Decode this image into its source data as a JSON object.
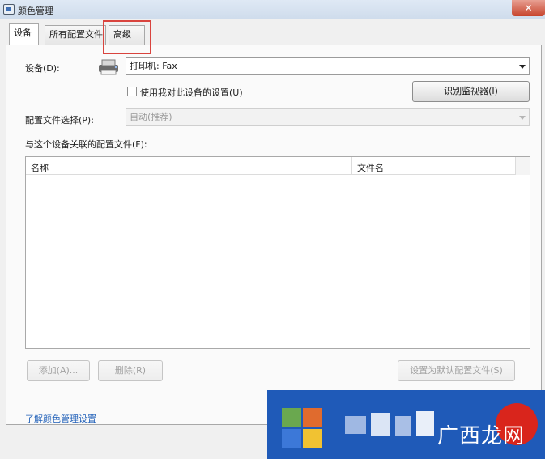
{
  "window": {
    "title": "颜色管理",
    "close_glyph": "✕"
  },
  "tabs": [
    {
      "label": "设备",
      "active": true
    },
    {
      "label": "所有配置文件",
      "active": false
    },
    {
      "label": "高级",
      "active": false
    }
  ],
  "device": {
    "label": "设备(D):",
    "selected": "打印机: Fax",
    "use_settings_label": "使用我对此设备的设置(U)",
    "use_settings_checked": false,
    "identify_button": "识别监视器(I)"
  },
  "profile_selection": {
    "label": "配置文件选择(P):",
    "selected": "自动(推荐)"
  },
  "associated_profiles": {
    "label": "与这个设备关联的配置文件(F):",
    "columns": [
      "名称",
      "文件名"
    ],
    "rows": []
  },
  "buttons": {
    "add": "添加(A)...",
    "remove": "删除(R)",
    "set_default": "设置为默认配置文件(S)"
  },
  "footer": {
    "learn_link": "了解颜色管理设置"
  },
  "watermark": {
    "text": "广西龙网"
  },
  "colors": {
    "highlight_box": "#d9443e",
    "link": "#1f5fb8",
    "watermark_bg": "#1f5ab8"
  }
}
